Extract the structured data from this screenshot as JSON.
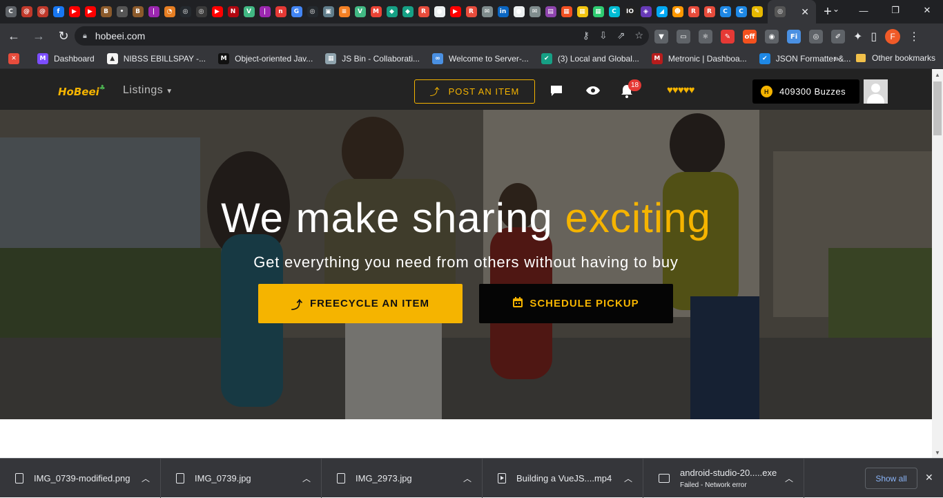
{
  "browser": {
    "tab_favicons": [
      {
        "name": "tab-chrome-icon",
        "glyph": "C",
        "color": "#5f6368"
      },
      {
        "name": "tab-spiral-icon",
        "glyph": "@",
        "color": "#c0392b"
      },
      {
        "name": "tab-spiral-icon",
        "glyph": "@",
        "color": "#c0392b"
      },
      {
        "name": "tab-facebook-icon",
        "glyph": "f",
        "color": "#1877f2"
      },
      {
        "name": "tab-youtube-icon",
        "glyph": "▶",
        "color": "#ff0000"
      },
      {
        "name": "tab-youtube-icon",
        "glyph": "▶",
        "color": "#ff0000"
      },
      {
        "name": "tab-page-icon",
        "glyph": "B",
        "color": "#8b5a2b"
      },
      {
        "name": "tab-avatar-icon",
        "glyph": "•",
        "color": "#555"
      },
      {
        "name": "tab-page-icon",
        "glyph": "B",
        "color": "#8b5a2b"
      },
      {
        "name": "tab-bar-icon",
        "glyph": "|",
        "color": "#9c27b0"
      },
      {
        "name": "tab-chart-icon",
        "glyph": "◔",
        "color": "#e67e22"
      },
      {
        "name": "tab-github-icon",
        "glyph": "◎",
        "color": "#24292e"
      },
      {
        "name": "tab-github-icon",
        "glyph": "◎",
        "color": "#3a3a3a"
      },
      {
        "name": "tab-youtube-icon",
        "glyph": "▶",
        "color": "#ff0000"
      },
      {
        "name": "tab-netflix-icon",
        "glyph": "N",
        "color": "#b20710"
      },
      {
        "name": "tab-vue-icon",
        "glyph": "V",
        "color": "#41b883"
      },
      {
        "name": "tab-bar-icon",
        "glyph": "|",
        "color": "#9c27b0"
      },
      {
        "name": "tab-page-icon",
        "glyph": "n",
        "color": "#e53935"
      },
      {
        "name": "tab-google-icon",
        "glyph": "G",
        "color": "#4285f4"
      },
      {
        "name": "tab-github-icon",
        "glyph": "◎",
        "color": "#24292e"
      },
      {
        "name": "tab-box-icon",
        "glyph": "▣",
        "color": "#607d8b"
      },
      {
        "name": "tab-stack-icon",
        "glyph": "≡",
        "color": "#f48024"
      },
      {
        "name": "tab-vue-icon",
        "glyph": "V",
        "color": "#41b883"
      },
      {
        "name": "tab-gmail-icon",
        "glyph": "M",
        "color": "#ea4335"
      },
      {
        "name": "tab-diamond-icon",
        "glyph": "◆",
        "color": "#16a085"
      },
      {
        "name": "tab-diamond-icon",
        "glyph": "◆",
        "color": "#16a085"
      },
      {
        "name": "tab-react-icon",
        "glyph": "R",
        "color": "#e74c3c"
      },
      {
        "name": "tab-circle-icon",
        "glyph": "●",
        "color": "#ecf0f1"
      },
      {
        "name": "tab-youtube-icon",
        "glyph": "▶",
        "color": "#ff0000"
      },
      {
        "name": "tab-react-icon",
        "glyph": "R",
        "color": "#e74c3c"
      },
      {
        "name": "tab-mail-icon",
        "glyph": "✉",
        "color": "#7f8c8d"
      },
      {
        "name": "tab-linkedin-icon",
        "glyph": "in",
        "color": "#0a66c2"
      },
      {
        "name": "tab-circle-icon",
        "glyph": "●",
        "color": "#ecf0f1"
      },
      {
        "name": "tab-mail-icon",
        "glyph": "✉",
        "color": "#7f8c8d"
      },
      {
        "name": "tab-box-icon",
        "glyph": "▤",
        "color": "#8e44ad"
      },
      {
        "name": "tab-microsoft-icon",
        "glyph": "▦",
        "color": "#f25022"
      },
      {
        "name": "tab-colors-icon",
        "glyph": "▦",
        "color": "#f1c40f"
      },
      {
        "name": "tab-colors-icon",
        "glyph": "▦",
        "color": "#2ecc71"
      },
      {
        "name": "tab-c-icon",
        "glyph": "C",
        "color": "#00bcd4"
      },
      {
        "name": "tab-io-icon",
        "glyph": "IO",
        "color": "#222"
      },
      {
        "name": "tab-shield-icon",
        "glyph": "◈",
        "color": "#673ab7"
      },
      {
        "name": "tab-shape-icon",
        "glyph": "◢",
        "color": "#03a9f4"
      },
      {
        "name": "tab-monkey-icon",
        "glyph": "☻",
        "color": "#ff9800"
      },
      {
        "name": "tab-react-icon",
        "glyph": "R",
        "color": "#e74c3c"
      },
      {
        "name": "tab-react-icon",
        "glyph": "R",
        "color": "#e74c3c"
      },
      {
        "name": "tab-c-icon",
        "glyph": "C",
        "color": "#1e88e5"
      },
      {
        "name": "tab-c-icon",
        "glyph": "C",
        "color": "#1e88e5"
      },
      {
        "name": "tab-pen-icon",
        "glyph": "✎",
        "color": "#e6b800"
      }
    ],
    "active_tab_favicon": {
      "glyph": "◎",
      "color": "#ffffff"
    },
    "address": "hobeei.com",
    "extensions": [
      {
        "name": "vue-devtools-icon",
        "glyph": "▼",
        "color": "#5f6368"
      },
      {
        "name": "camera-ext-icon",
        "glyph": "▭",
        "color": "#5f6368"
      },
      {
        "name": "react-ext-icon",
        "glyph": "⚛",
        "color": "#5f6368"
      },
      {
        "name": "pen-ext-icon",
        "glyph": "✎",
        "color": "#e53935"
      },
      {
        "name": "off-ext-icon",
        "glyph": "off",
        "color": "#f4511e"
      },
      {
        "name": "circle-ext-icon",
        "glyph": "◉",
        "color": "#5f6368"
      },
      {
        "name": "fi-ext-icon",
        "glyph": "Fi",
        "color": "#4a90e2"
      },
      {
        "name": "target-ext-icon",
        "glyph": "◎",
        "color": "#5f6368"
      },
      {
        "name": "dropper-ext-icon",
        "glyph": "✐",
        "color": "#5f6368"
      }
    ],
    "profile_initial": "F",
    "bookmarks": [
      {
        "label": "",
        "glyph": "✕",
        "color": "#e74c3c"
      },
      {
        "label": "Dashboard",
        "glyph": "M",
        "color": "#7c4dff"
      },
      {
        "label": "NIBSS EBILLSPAY -...",
        "glyph": "▲",
        "color": "#f5f5f5"
      },
      {
        "label": "Object-oriented Jav...",
        "glyph": "M",
        "color": "#111"
      },
      {
        "label": "JS Bin - Collaborati...",
        "glyph": "▦",
        "color": "#90a4ae"
      },
      {
        "label": "Welcome to Server-...",
        "glyph": "∞",
        "color": "#4a90e2"
      },
      {
        "label": "(3) Local and Global...",
        "glyph": "✔",
        "color": "#16a085"
      },
      {
        "label": "Metronic | Dashboa...",
        "glyph": "M",
        "color": "#b71c1c"
      },
      {
        "label": "JSON Formatter &...",
        "glyph": "✔",
        "color": "#1e88e5"
      }
    ],
    "bookmarks_more": "»",
    "other_bookmarks": "Other bookmarks"
  },
  "site": {
    "logo": "HoBeei",
    "listings_label": "Listings",
    "post_item_label": "POST AN ITEM",
    "notification_count": "18",
    "hearts": "♥♥♥♥♥",
    "buzz_label": "409300 Buzzes",
    "buzz_coin": "H",
    "headline_main": "We make sharing",
    "headline_accent": "exciting",
    "subheadline": "Get everything you need from others without having to buy",
    "cta_primary": "FREECYCLE AN ITEM",
    "cta_secondary": "SCHEDULE PICKUP",
    "accent_color": "#f5b400"
  },
  "downloads": {
    "items": [
      {
        "name": "IMG_0739-modified.png",
        "status": ""
      },
      {
        "name": "IMG_0739.jpg",
        "status": ""
      },
      {
        "name": "IMG_2973.jpg",
        "status": ""
      },
      {
        "name": "Building a VueJS....mp4",
        "status": ""
      },
      {
        "name": "android-studio-20.....exe",
        "status": "Failed - Network error"
      }
    ],
    "show_all_label": "Show all"
  }
}
